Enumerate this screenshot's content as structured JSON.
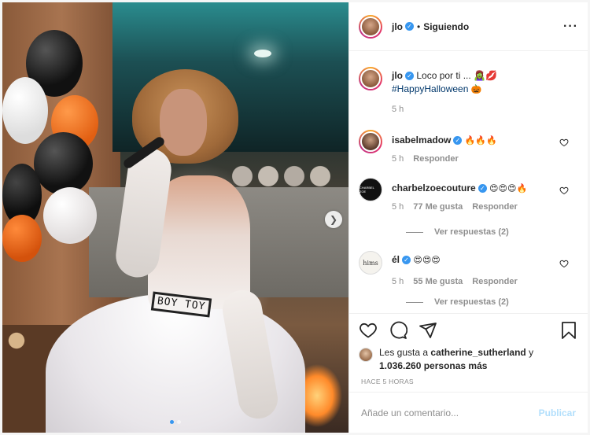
{
  "post": {
    "author": "jlo",
    "follow_status": "Siguiendo",
    "more_icon": "more-horizontal-icon",
    "caption_text": "Loco por ti ... 🧟‍♀️💋",
    "caption_hashtag": "#HappyHalloween",
    "caption_emoji": "🎃",
    "caption_time": "5 h",
    "belt_text": "BOY TOY"
  },
  "comments": [
    {
      "user": "isabelmadow",
      "text": "🔥🔥🔥",
      "time": "5 h",
      "reply_label": "Responder",
      "likes": ""
    },
    {
      "user": "charbelzoecouture",
      "text": "😍😍😍🔥",
      "time": "5 h",
      "likes": "77 Me gusta",
      "reply_label": "Responder",
      "view_replies": "Ver respuestas (2)",
      "avatar_text": "CHARBEL ZOE"
    },
    {
      "user": "él",
      "text": "😍😍😍",
      "time": "5 h",
      "likes": "55 Me gusta",
      "reply_label": "Responder",
      "view_replies": "Ver respuestas (2)",
      "avatar_text": "hims"
    }
  ],
  "likes_summary": {
    "prefix": "Les gusta a ",
    "user": "catherine_sutherland",
    "connector": " y",
    "others": "1.036.260 personas más"
  },
  "time_ago": "HACE 5 HORAS",
  "comment_box": {
    "placeholder": "Añade un comentario...",
    "publish_label": "Publicar"
  },
  "colors": {
    "accent": "#3897f0",
    "publish_disabled": "#b2dffc",
    "text": "#262626",
    "secondary": "#8e8e8e"
  },
  "carousel": {
    "slides": 2,
    "active_slide": 1
  }
}
